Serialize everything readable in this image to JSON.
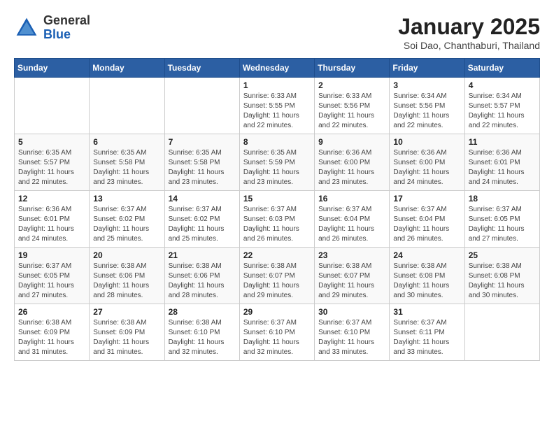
{
  "logo": {
    "general": "General",
    "blue": "Blue"
  },
  "header": {
    "title": "January 2025",
    "location": "Soi Dao, Chanthaburi, Thailand"
  },
  "weekdays": [
    "Sunday",
    "Monday",
    "Tuesday",
    "Wednesday",
    "Thursday",
    "Friday",
    "Saturday"
  ],
  "weeks": [
    [
      {
        "day": "",
        "info": ""
      },
      {
        "day": "",
        "info": ""
      },
      {
        "day": "",
        "info": ""
      },
      {
        "day": "1",
        "info": "Sunrise: 6:33 AM\nSunset: 5:55 PM\nDaylight: 11 hours and 22 minutes."
      },
      {
        "day": "2",
        "info": "Sunrise: 6:33 AM\nSunset: 5:56 PM\nDaylight: 11 hours and 22 minutes."
      },
      {
        "day": "3",
        "info": "Sunrise: 6:34 AM\nSunset: 5:56 PM\nDaylight: 11 hours and 22 minutes."
      },
      {
        "day": "4",
        "info": "Sunrise: 6:34 AM\nSunset: 5:57 PM\nDaylight: 11 hours and 22 minutes."
      }
    ],
    [
      {
        "day": "5",
        "info": "Sunrise: 6:35 AM\nSunset: 5:57 PM\nDaylight: 11 hours and 22 minutes."
      },
      {
        "day": "6",
        "info": "Sunrise: 6:35 AM\nSunset: 5:58 PM\nDaylight: 11 hours and 23 minutes."
      },
      {
        "day": "7",
        "info": "Sunrise: 6:35 AM\nSunset: 5:58 PM\nDaylight: 11 hours and 23 minutes."
      },
      {
        "day": "8",
        "info": "Sunrise: 6:35 AM\nSunset: 5:59 PM\nDaylight: 11 hours and 23 minutes."
      },
      {
        "day": "9",
        "info": "Sunrise: 6:36 AM\nSunset: 6:00 PM\nDaylight: 11 hours and 23 minutes."
      },
      {
        "day": "10",
        "info": "Sunrise: 6:36 AM\nSunset: 6:00 PM\nDaylight: 11 hours and 24 minutes."
      },
      {
        "day": "11",
        "info": "Sunrise: 6:36 AM\nSunset: 6:01 PM\nDaylight: 11 hours and 24 minutes."
      }
    ],
    [
      {
        "day": "12",
        "info": "Sunrise: 6:36 AM\nSunset: 6:01 PM\nDaylight: 11 hours and 24 minutes."
      },
      {
        "day": "13",
        "info": "Sunrise: 6:37 AM\nSunset: 6:02 PM\nDaylight: 11 hours and 25 minutes."
      },
      {
        "day": "14",
        "info": "Sunrise: 6:37 AM\nSunset: 6:02 PM\nDaylight: 11 hours and 25 minutes."
      },
      {
        "day": "15",
        "info": "Sunrise: 6:37 AM\nSunset: 6:03 PM\nDaylight: 11 hours and 26 minutes."
      },
      {
        "day": "16",
        "info": "Sunrise: 6:37 AM\nSunset: 6:04 PM\nDaylight: 11 hours and 26 minutes."
      },
      {
        "day": "17",
        "info": "Sunrise: 6:37 AM\nSunset: 6:04 PM\nDaylight: 11 hours and 26 minutes."
      },
      {
        "day": "18",
        "info": "Sunrise: 6:37 AM\nSunset: 6:05 PM\nDaylight: 11 hours and 27 minutes."
      }
    ],
    [
      {
        "day": "19",
        "info": "Sunrise: 6:37 AM\nSunset: 6:05 PM\nDaylight: 11 hours and 27 minutes."
      },
      {
        "day": "20",
        "info": "Sunrise: 6:38 AM\nSunset: 6:06 PM\nDaylight: 11 hours and 28 minutes."
      },
      {
        "day": "21",
        "info": "Sunrise: 6:38 AM\nSunset: 6:06 PM\nDaylight: 11 hours and 28 minutes."
      },
      {
        "day": "22",
        "info": "Sunrise: 6:38 AM\nSunset: 6:07 PM\nDaylight: 11 hours and 29 minutes."
      },
      {
        "day": "23",
        "info": "Sunrise: 6:38 AM\nSunset: 6:07 PM\nDaylight: 11 hours and 29 minutes."
      },
      {
        "day": "24",
        "info": "Sunrise: 6:38 AM\nSunset: 6:08 PM\nDaylight: 11 hours and 30 minutes."
      },
      {
        "day": "25",
        "info": "Sunrise: 6:38 AM\nSunset: 6:08 PM\nDaylight: 11 hours and 30 minutes."
      }
    ],
    [
      {
        "day": "26",
        "info": "Sunrise: 6:38 AM\nSunset: 6:09 PM\nDaylight: 11 hours and 31 minutes."
      },
      {
        "day": "27",
        "info": "Sunrise: 6:38 AM\nSunset: 6:09 PM\nDaylight: 11 hours and 31 minutes."
      },
      {
        "day": "28",
        "info": "Sunrise: 6:38 AM\nSunset: 6:10 PM\nDaylight: 11 hours and 32 minutes."
      },
      {
        "day": "29",
        "info": "Sunrise: 6:37 AM\nSunset: 6:10 PM\nDaylight: 11 hours and 32 minutes."
      },
      {
        "day": "30",
        "info": "Sunrise: 6:37 AM\nSunset: 6:10 PM\nDaylight: 11 hours and 33 minutes."
      },
      {
        "day": "31",
        "info": "Sunrise: 6:37 AM\nSunset: 6:11 PM\nDaylight: 11 hours and 33 minutes."
      },
      {
        "day": "",
        "info": ""
      }
    ]
  ]
}
